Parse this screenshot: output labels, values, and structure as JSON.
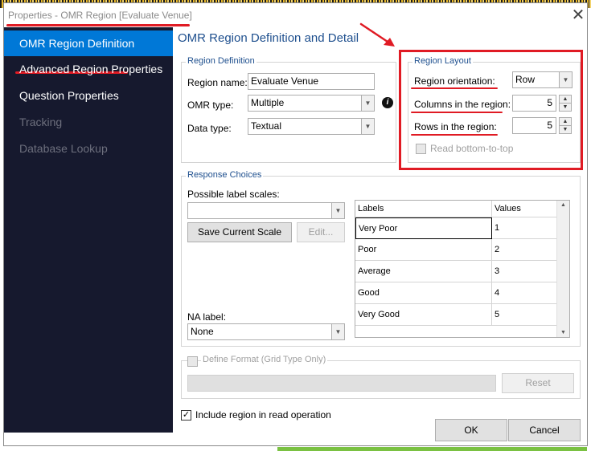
{
  "window": {
    "title": "Properties - OMR Region [Evaluate Venue]",
    "close_glyph": "✕"
  },
  "sidebar": {
    "items": [
      {
        "label": "OMR Region Definition",
        "state": "active"
      },
      {
        "label": "Advanced Region Properties",
        "state": "normal"
      },
      {
        "label": "Question Properties",
        "state": "normal"
      },
      {
        "label": "Tracking",
        "state": "disabled"
      },
      {
        "label": "Database Lookup",
        "state": "disabled"
      }
    ]
  },
  "main": {
    "title": "OMR Region Definition and Detail",
    "region_definition": {
      "group_label": "Region Definition",
      "name_label": "Region name:",
      "name_value": "Evaluate Venue",
      "omr_type_label": "OMR type:",
      "omr_type_value": "Multiple",
      "data_type_label": "Data type:",
      "data_type_value": "Textual",
      "info_icon": "i"
    },
    "region_layout": {
      "group_label": "Region Layout",
      "orientation_label": "Region orientation:",
      "orientation_value": "Row",
      "columns_label": "Columns in the region:",
      "columns_value": "5",
      "rows_label": "Rows in the region:",
      "rows_value": "5",
      "read_bottom_label": "Read bottom-to-top",
      "read_bottom_checked": false
    },
    "response_choices": {
      "group_label": "Response Choices",
      "scales_label": "Possible label scales:",
      "scale_value": "",
      "save_scale_button": "Save Current Scale",
      "edit_button": "Edit...",
      "na_label": "NA label:",
      "na_value": "None",
      "table": {
        "headers": [
          "Labels",
          "Values"
        ],
        "rows": [
          [
            "Very Poor",
            "1"
          ],
          [
            "Poor",
            "2"
          ],
          [
            "Average",
            "3"
          ],
          [
            "Good",
            "4"
          ],
          [
            "Very Good",
            "5"
          ]
        ]
      }
    },
    "define_format": {
      "label": "Define Format (Grid Type Only)",
      "reset_button": "Reset"
    },
    "include_region": {
      "label": "Include region in read operation",
      "checked": true,
      "check_glyph": "✓"
    },
    "ok_button": "OK",
    "cancel_button": "Cancel"
  },
  "colors": {
    "accent": "#0078d7",
    "sidebar_bg": "#16192e",
    "annotation_red": "#e01b24",
    "heading_blue": "#1e4f8e"
  }
}
